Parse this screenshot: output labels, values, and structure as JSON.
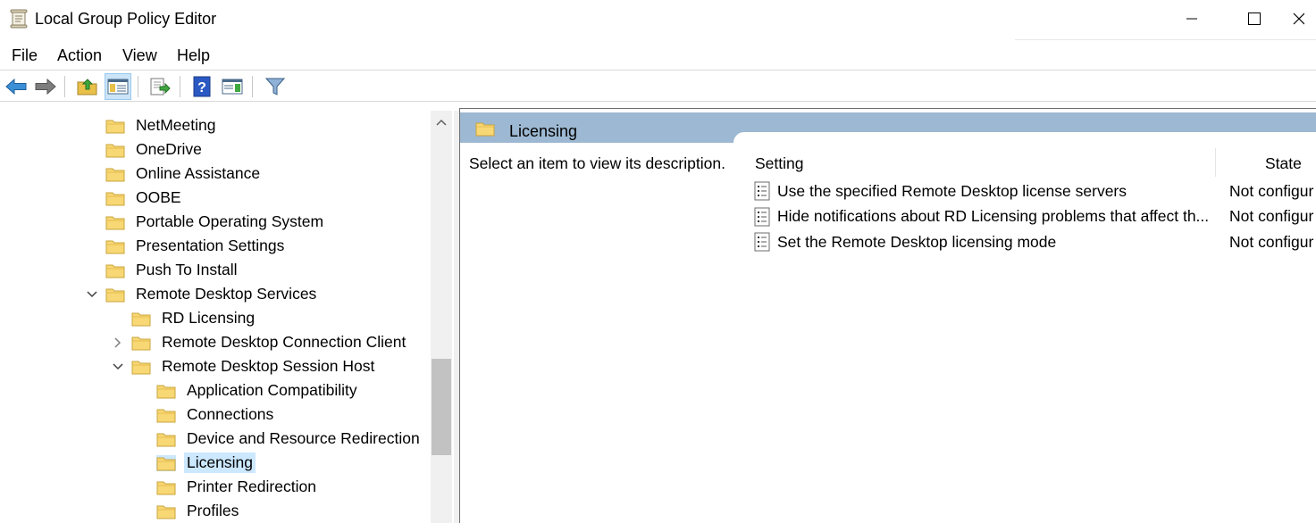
{
  "window": {
    "title": "Local Group Policy Editor",
    "icon": "policy-editor-icon"
  },
  "menu": {
    "file": "File",
    "action": "Action",
    "view": "View",
    "help": "Help"
  },
  "toolbar": {
    "buttons": [
      "back-arrow-icon",
      "forward-arrow-icon",
      "up-folder-icon",
      "show-hide-tree-icon",
      "export-list-icon",
      "help-icon",
      "show-hide-action-pane-icon",
      "filter-icon"
    ]
  },
  "tree": {
    "items": [
      {
        "label": "NetMeeting",
        "depth": 0,
        "expander": "none"
      },
      {
        "label": "OneDrive",
        "depth": 0,
        "expander": "none"
      },
      {
        "label": "Online Assistance",
        "depth": 0,
        "expander": "none"
      },
      {
        "label": "OOBE",
        "depth": 0,
        "expander": "none"
      },
      {
        "label": "Portable Operating System",
        "depth": 0,
        "expander": "none"
      },
      {
        "label": "Presentation Settings",
        "depth": 0,
        "expander": "none"
      },
      {
        "label": "Push To Install",
        "depth": 0,
        "expander": "none"
      },
      {
        "label": "Remote Desktop Services",
        "depth": 0,
        "expander": "expanded"
      },
      {
        "label": "RD Licensing",
        "depth": 1,
        "expander": "none"
      },
      {
        "label": "Remote Desktop Connection Client",
        "depth": 1,
        "expander": "collapsed"
      },
      {
        "label": "Remote Desktop Session Host",
        "depth": 1,
        "expander": "expanded"
      },
      {
        "label": "Application Compatibility",
        "depth": 2,
        "expander": "none"
      },
      {
        "label": "Connections",
        "depth": 2,
        "expander": "none"
      },
      {
        "label": "Device and Resource Redirection",
        "depth": 2,
        "expander": "none"
      },
      {
        "label": "Licensing",
        "depth": 2,
        "expander": "none",
        "selected": true
      },
      {
        "label": "Printer Redirection",
        "depth": 2,
        "expander": "none"
      },
      {
        "label": "Profiles",
        "depth": 2,
        "expander": "none"
      }
    ]
  },
  "details": {
    "header_title": "Licensing",
    "description": "Select an item to view its description.",
    "columns": {
      "setting": "Setting",
      "state": "State"
    },
    "rows": [
      {
        "name": "Use the specified Remote Desktop license servers",
        "state": "Not configur"
      },
      {
        "name": "Hide notifications about RD Licensing problems that affect th...",
        "state": "Not configur"
      },
      {
        "name": "Set the Remote Desktop licensing mode",
        "state": "Not configur"
      }
    ]
  },
  "colors": {
    "header_band": "#9db8d2",
    "selection": "#cce8ff",
    "folder": "#f8d775"
  }
}
